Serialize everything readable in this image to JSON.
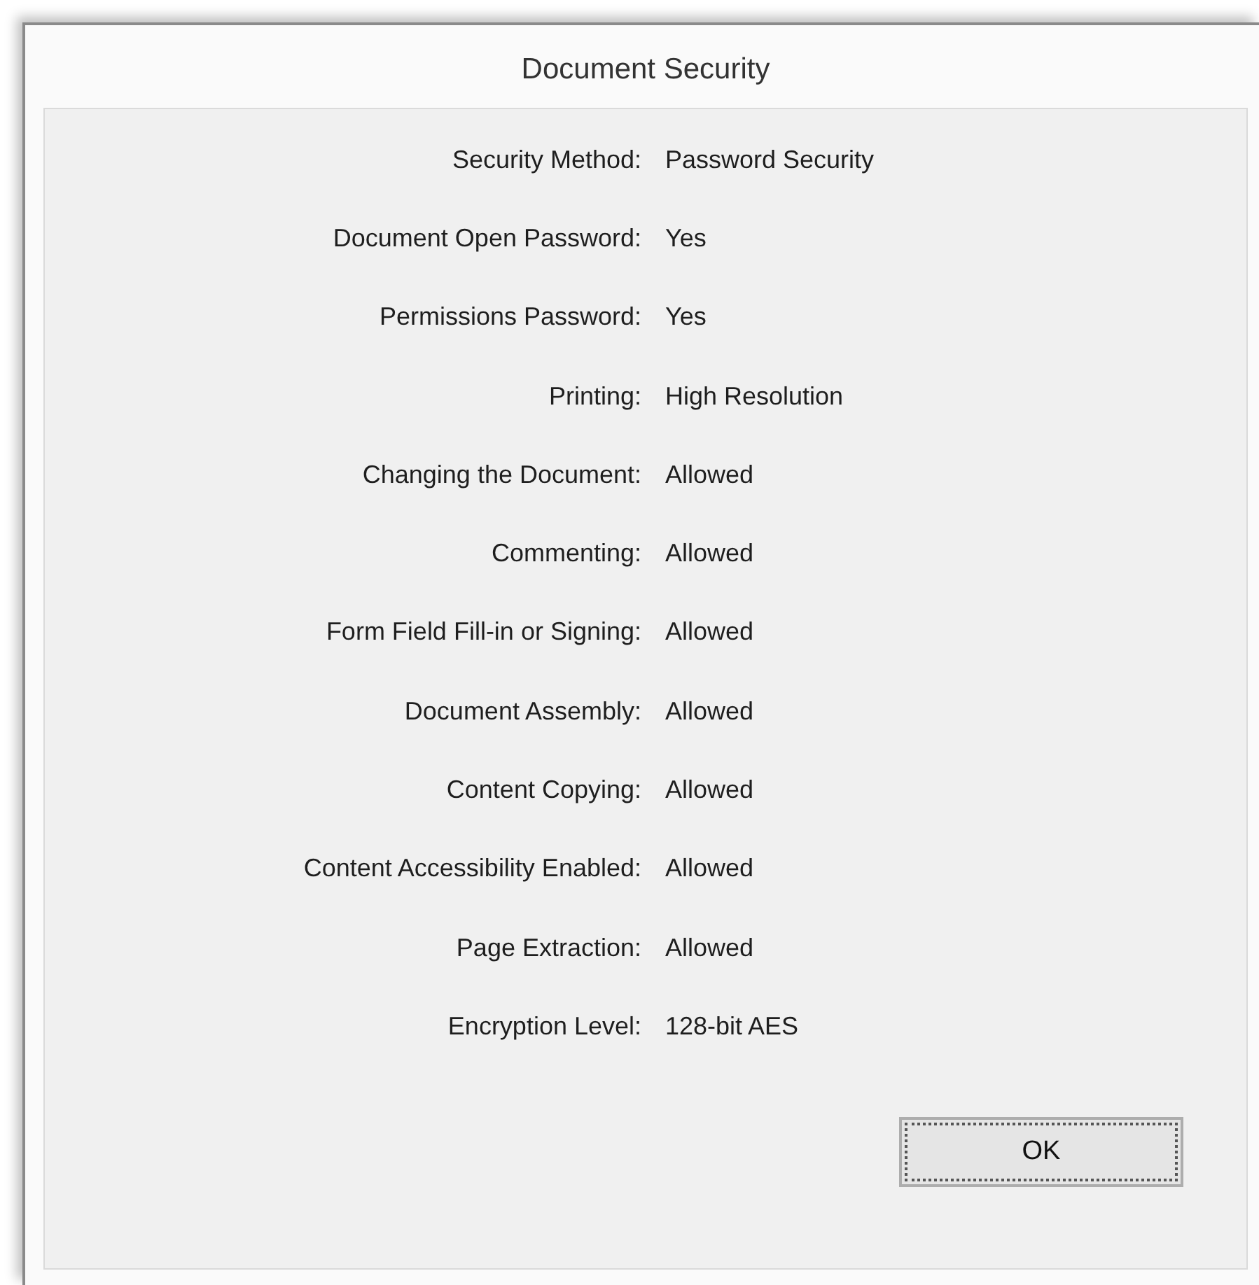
{
  "window": {
    "title": "Document Security"
  },
  "properties": [
    {
      "label": "Security Method:",
      "value": "Password Security"
    },
    {
      "label": "Document Open Password:",
      "value": "Yes"
    },
    {
      "label": "Permissions Password:",
      "value": "Yes"
    },
    {
      "label": "Printing:",
      "value": "High Resolution"
    },
    {
      "label": "Changing the Document:",
      "value": "Allowed"
    },
    {
      "label": "Commenting:",
      "value": "Allowed"
    },
    {
      "label": "Form Field Fill-in or Signing:",
      "value": "Allowed"
    },
    {
      "label": "Document Assembly:",
      "value": "Allowed"
    },
    {
      "label": "Content Copying:",
      "value": "Allowed"
    },
    {
      "label": "Content Accessibility Enabled:",
      "value": "Allowed"
    },
    {
      "label": "Page Extraction:",
      "value": "Allowed"
    },
    {
      "label": "Encryption Level:",
      "value": "128-bit AES"
    }
  ],
  "buttons": [
    {
      "label": "OK",
      "focused": true
    }
  ]
}
